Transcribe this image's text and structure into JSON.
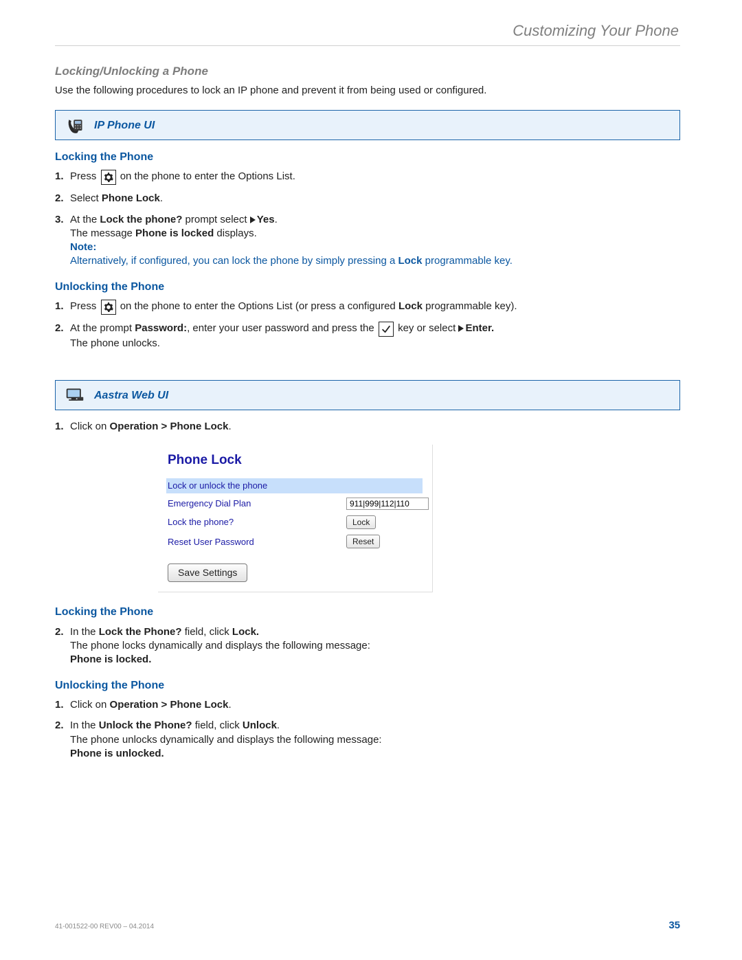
{
  "header": {
    "title": "Customizing Your Phone"
  },
  "section": {
    "title": "Locking/Unlocking a Phone"
  },
  "intro": "Use the following procedures to lock an IP phone and prevent it from being used or configured.",
  "ip_band": {
    "label": "IP Phone UI"
  },
  "ip_lock": {
    "heading": "Locking the Phone",
    "s1": {
      "num": "1.",
      "a": "Press ",
      "b": " on the phone to enter the Options List."
    },
    "s2": {
      "num": "2.",
      "a": "Select ",
      "b": "Phone Lock",
      "c": "."
    },
    "s3": {
      "num": "3.",
      "a": "At the ",
      "b": "Lock the phone?",
      "c": " prompt select ",
      "d": "Yes",
      "e": ".",
      "line2a": "The message ",
      "line2b": "Phone is locked",
      "line2c": " displays.",
      "note_label": "Note:",
      "note_body": "Alternatively, if configured, you can lock the phone by simply pressing a ",
      "note_bold": "Lock",
      "note_tail": " programmable key."
    }
  },
  "ip_unlock": {
    "heading": "Unlocking the Phone",
    "s1": {
      "num": "1.",
      "a": "Press ",
      "b": " on the phone to enter the Options List (or press a configured ",
      "c": "Lock",
      "d": " programmable key)."
    },
    "s2": {
      "num": "2.",
      "a": "At the prompt ",
      "b": "Password:",
      "c": ", enter your user password and press the ",
      "d": " key or select ",
      "e": "Enter.",
      "line2": "The phone unlocks."
    }
  },
  "web_band": {
    "label": "Aastra Web UI"
  },
  "web_step1": {
    "num": "1.",
    "a": "Click on ",
    "b": "Operation > Phone Lock",
    "c": "."
  },
  "webui": {
    "title": "Phone Lock",
    "row_lockunlock": "Lock or unlock the phone",
    "row_dialplan_label": "Emergency Dial Plan",
    "row_dialplan_value": "911|999|112|110",
    "row_lockq_label": "Lock the phone?",
    "row_lockq_btn": "Lock",
    "row_reset_label": "Reset User Password",
    "row_reset_btn": "Reset",
    "save_btn": "Save Settings"
  },
  "web_lock": {
    "heading": "Locking the Phone",
    "s2": {
      "num": "2.",
      "a": "In the ",
      "b": "Lock the Phone?",
      "c": " field, click ",
      "d": "Lock.",
      "line2": "The phone locks dynamically and displays the following message:",
      "line3": "Phone is locked."
    }
  },
  "web_unlock": {
    "heading": "Unlocking the Phone",
    "s1": {
      "num": "1.",
      "a": "Click on ",
      "b": "Operation > Phone Lock",
      "c": "."
    },
    "s2": {
      "num": "2.",
      "a": "In the ",
      "b": "Unlock the Phone?",
      "c": " field, click ",
      "d": "Unlock",
      "e": ".",
      "line2": "The phone unlocks dynamically and displays the following message:",
      "line3": "Phone is unlocked."
    }
  },
  "footer": {
    "doc": "41-001522-00 REV00 – 04.2014",
    "page": "35"
  }
}
